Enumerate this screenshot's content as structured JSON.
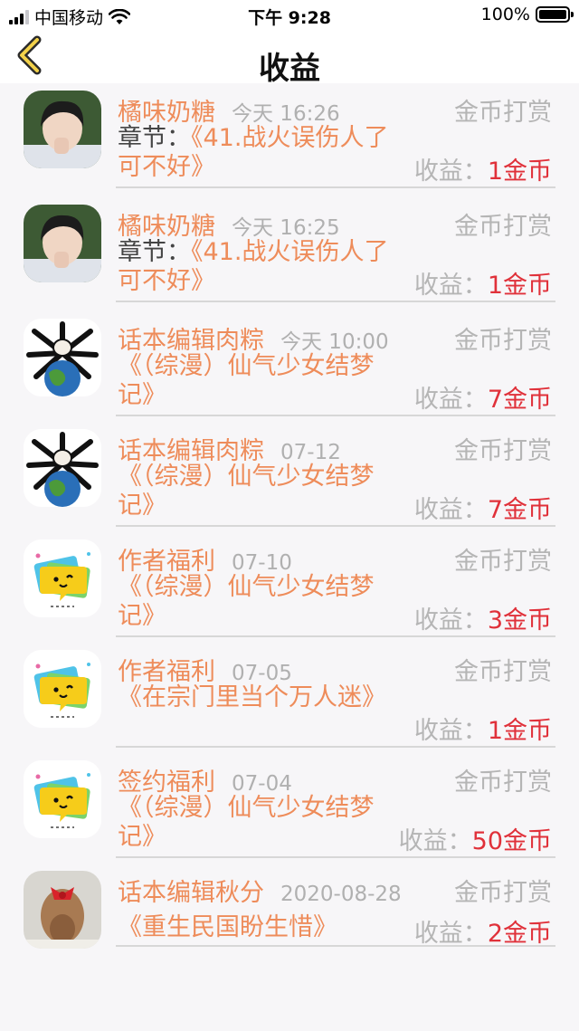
{
  "status_bar": {
    "carrier": "中国移动",
    "time": "下午 9:28",
    "battery": "100%"
  },
  "nav": {
    "title": "收益",
    "back_icon": "chevron-left-icon"
  },
  "labels": {
    "chapter_prefix": "章节：",
    "earn_prefix": "收益："
  },
  "colors": {
    "accent": "#ee8c5a",
    "amount": "#e0313a",
    "muted": "#b5b5b5"
  },
  "records": [
    {
      "name": "橘味奶糖",
      "time": "今天 16:26",
      "type": "金币打赏",
      "chapter": "《41.战火误伤人了可不好》",
      "amount": "1金币",
      "avatar": "boy-photo"
    },
    {
      "name": "橘味奶糖",
      "time": "今天 16:25",
      "type": "金币打赏",
      "chapter": "《41.战火误伤人了可不好》",
      "amount": "1金币",
      "avatar": "boy-photo"
    },
    {
      "name": "话本编辑肉粽",
      "time": "今天 10:00",
      "type": "金币打赏",
      "work": "《（综漫）仙气少女结梦记》",
      "amount": "7金币",
      "avatar": "earth-bones"
    },
    {
      "name": "话本编辑肉粽",
      "time": "07-12",
      "type": "金币打赏",
      "work": "《（综漫）仙气少女结梦记》",
      "amount": "7金币",
      "avatar": "earth-bones"
    },
    {
      "name": "作者福利",
      "time": "07-10",
      "type": "金币打赏",
      "work": "《（综漫）仙气少女结梦记》",
      "amount": "3金币",
      "avatar": "yellow-chat"
    },
    {
      "name": "作者福利",
      "time": "07-05",
      "type": "金币打赏",
      "work": "《在宗门里当个万人迷》",
      "amount": "1金币",
      "avatar": "yellow-chat"
    },
    {
      "name": "签约福利",
      "time": "07-04",
      "type": "金币打赏",
      "work": "《（综漫）仙气少女结梦记》",
      "amount": "50金币",
      "avatar": "yellow-chat"
    },
    {
      "name": "话本编辑秋分",
      "time": "2020-08-28",
      "type": "金币打赏",
      "work": "《重生民国盼生惜》",
      "amount": "2金币",
      "avatar": "girl-photo"
    }
  ]
}
